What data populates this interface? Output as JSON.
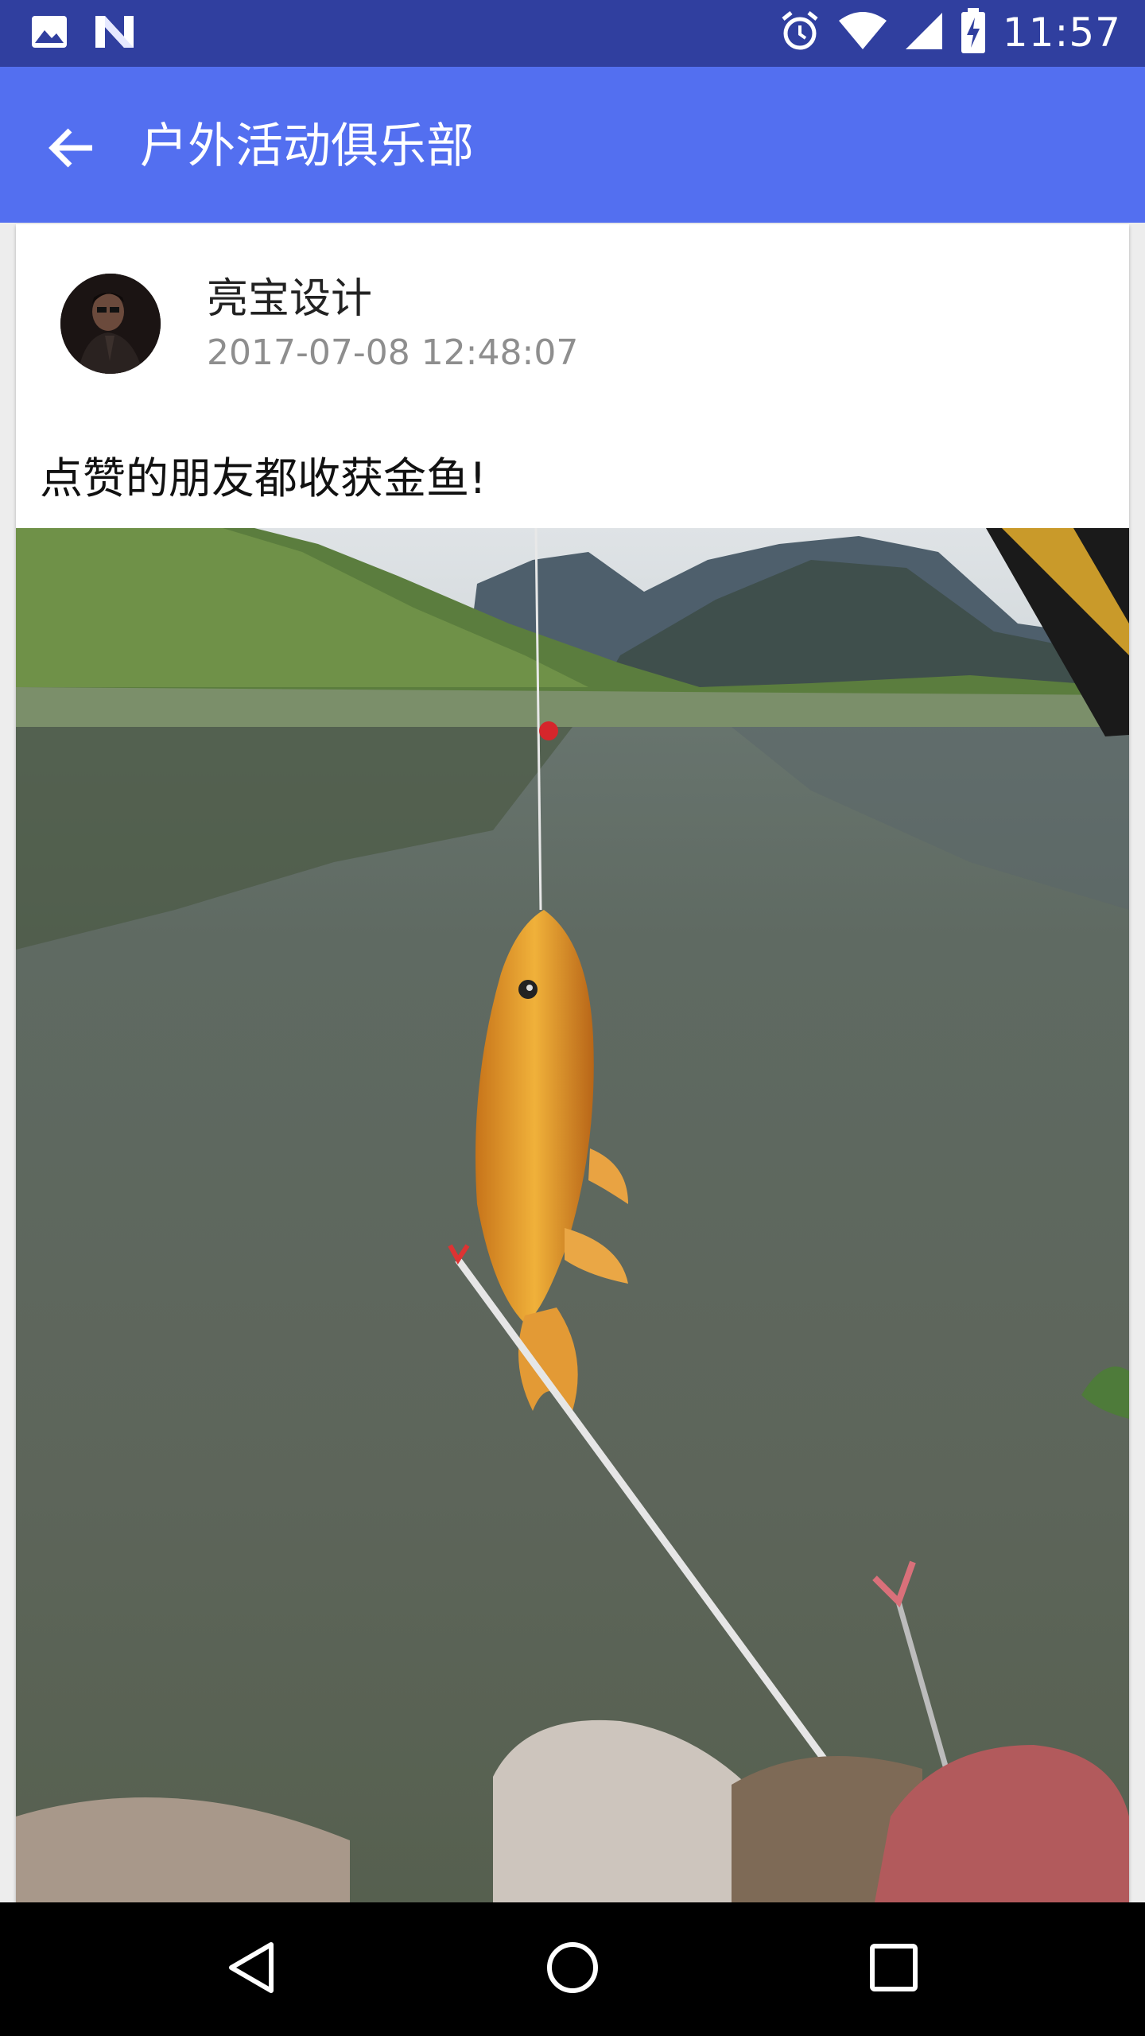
{
  "status_bar": {
    "time": "11:57",
    "left_icons": [
      "image-icon",
      "n-app-icon"
    ],
    "right_icons": [
      "alarm-icon",
      "wifi-icon",
      "signal-icon",
      "battery-charging-icon"
    ]
  },
  "app_bar": {
    "title": "户外活动俱乐部",
    "back_icon": "arrow-back-icon",
    "color": "#536ff0"
  },
  "post": {
    "author": "亮宝设计",
    "timestamp": "2017-07-08 12:48:07",
    "text": "点赞的朋友都收获金鱼!"
  },
  "nav_bar": {
    "icons": [
      "nav-back-icon",
      "nav-home-icon",
      "nav-recents-icon"
    ]
  },
  "colors": {
    "status_bar": "#303f9f",
    "app_bar": "#536ff0",
    "timestamp": "#8e8e8e"
  }
}
